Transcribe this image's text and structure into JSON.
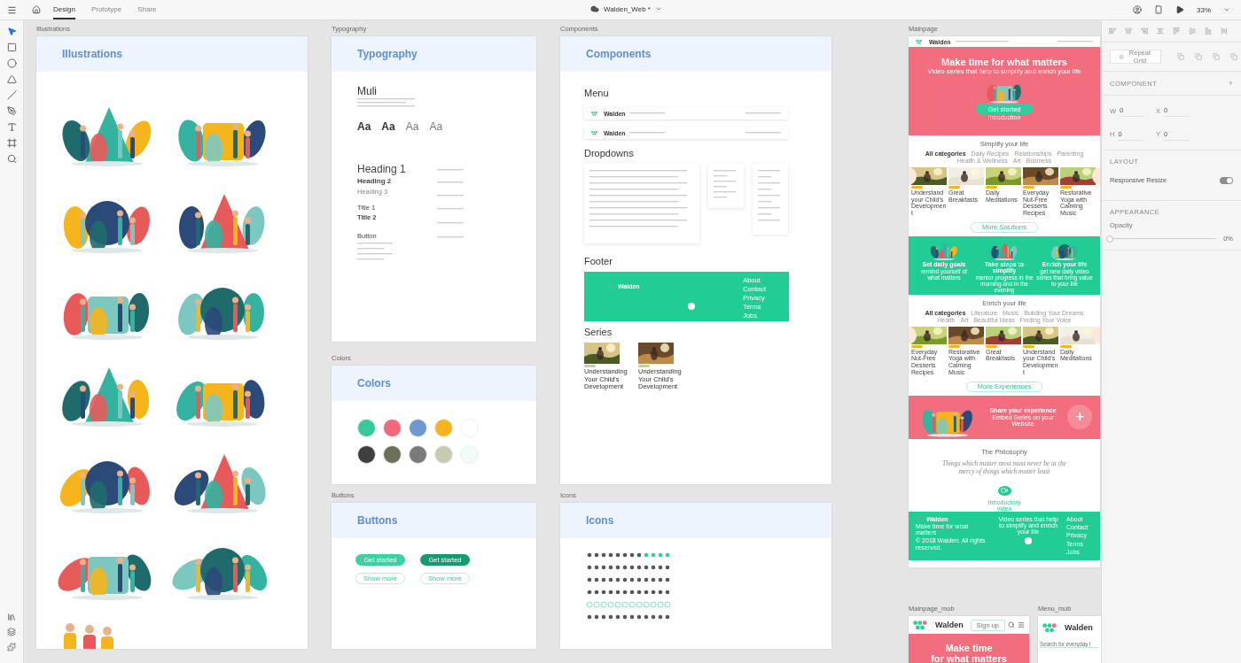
{
  "toolbar": {
    "tabs": [
      {
        "label": "Design",
        "selected": true
      },
      {
        "label": "Prototype",
        "selected": false
      },
      {
        "label": "Share",
        "selected": false
      }
    ],
    "document_title": "Walden_Web *",
    "zoom": "33%"
  },
  "tools": [
    {
      "kind": "select",
      "selected": true
    },
    {
      "kind": "rectangle",
      "selected": false
    },
    {
      "kind": "ellipse",
      "selected": false
    },
    {
      "kind": "triangle",
      "selected": false
    },
    {
      "kind": "line",
      "selected": false
    },
    {
      "kind": "pen",
      "selected": false
    },
    {
      "kind": "text",
      "selected": false
    },
    {
      "kind": "artboard",
      "selected": false
    },
    {
      "kind": "zoom",
      "selected": false
    }
  ],
  "bottom_tools": [
    {
      "kind": "assets"
    },
    {
      "kind": "layers"
    },
    {
      "kind": "plugins"
    }
  ],
  "illustrations_board": {
    "label": "Illustrations",
    "title": "Illustrations"
  },
  "typography_board": {
    "label": "Typography",
    "title": "Typography",
    "font": "Muli",
    "samples": [
      "Aa",
      "Aa",
      "Aa",
      "Aa"
    ],
    "styles": [
      {
        "label": "Heading 1",
        "kind": "h1"
      },
      {
        "label": "Heading 2",
        "kind": "h2"
      },
      {
        "label": "Heading 3",
        "kind": "h3"
      },
      {
        "label": "Title 1",
        "kind": "t1"
      },
      {
        "label": "Title 2",
        "kind": "t2"
      },
      {
        "label": "Button",
        "kind": "button"
      }
    ]
  },
  "colors_board": {
    "label": "Colors",
    "title": "Colors",
    "swatches": [
      {
        "color": "#35c99b"
      },
      {
        "color": "#f1697b"
      },
      {
        "color": "#6f98d2"
      },
      {
        "color": "#f6b51c"
      },
      {
        "color": "#ffffff"
      },
      {
        "color": "#3f3f3f"
      },
      {
        "color": "#6e7158"
      },
      {
        "color": "#7a7a7a"
      },
      {
        "color": "#c8cab4"
      },
      {
        "color": "#f1fbf7"
      }
    ]
  },
  "buttons_board": {
    "label": "Buttons",
    "title": "Buttons",
    "buttons": [
      {
        "label": "Get started",
        "kind": "primary"
      },
      {
        "label": "Get started",
        "kind": "pressed"
      },
      {
        "label": "Show more",
        "kind": "outline"
      },
      {
        "label": "Show more",
        "kind": "outline"
      }
    ]
  },
  "components_board": {
    "label": "Components",
    "title": "Components",
    "sections": [
      "Menu",
      "Dropdowns",
      "Footer",
      "Series"
    ],
    "menu_brands": [
      "Walden",
      "Walden"
    ],
    "footer_brand": "Walden",
    "footer_links": [
      "About",
      "Contact",
      "Privacy",
      "Terms",
      "Jobs"
    ],
    "series": [
      "Understanding Your Child's Development",
      "Understanding Your Child's Development"
    ]
  },
  "icons_board": {
    "label": "Icons",
    "title": "Icons"
  },
  "mainpage": {
    "label": "Mainpage",
    "brand": "Walden",
    "hero": {
      "title": "Make time for what matters",
      "subtitle": "Video series that help to simplify and enrich your life",
      "button": "Get started",
      "link": "Introduction"
    },
    "sections": [
      {
        "title": "Simplify your life",
        "tabs": [
          {
            "label": "All categories",
            "selected": true
          },
          {
            "label": "Daily Recipes",
            "selected": false
          },
          {
            "label": "Relationships",
            "selected": false
          },
          {
            "label": "Parenting",
            "selected": false
          },
          {
            "label": "Health & Wellness",
            "selected": false
          },
          {
            "label": "Art",
            "selected": false
          },
          {
            "label": "Business",
            "selected": false
          }
        ],
        "cards": [
          "Understand your Child's Development",
          "Great Breakfasts",
          "Daily Meditations",
          "Everyday Nut-Free Desserts Recipes",
          "Restorative Yoga with Calming Music"
        ],
        "button": "More Solutions"
      },
      {
        "title": "Enrich your life",
        "tabs": [
          {
            "label": "All categories",
            "selected": true
          },
          {
            "label": "Literature",
            "selected": false
          },
          {
            "label": "Music",
            "selected": false
          },
          {
            "label": "Building Your Dreams",
            "selected": false
          },
          {
            "label": "Health",
            "selected": false
          },
          {
            "label": "Art",
            "selected": false
          },
          {
            "label": "Beautiful Ideas",
            "selected": false
          },
          {
            "label": "Finding Your Voice",
            "selected": false
          }
        ],
        "cards": [
          "Everyday Nut-Free Desserts Recipes",
          "Restorative Yoga with Calming Music",
          "Great Breakfasts",
          "Understand your Child's Development",
          "Daily Meditations"
        ],
        "button": "More Experiences"
      }
    ],
    "steps": [
      {
        "title": "Set daily goals",
        "text": "remind yourself of what matters"
      },
      {
        "title": "Take steps to simplify",
        "text": "mentor progress in the morning and in the evening"
      },
      {
        "title": "Enrich your life",
        "text": "get new daily video series that bring value to your life"
      }
    ],
    "share": {
      "title": "Share your experience",
      "text": "Embed Series on your Website",
      "icon": "+"
    },
    "philosophy": {
      "title": "The Philosophy",
      "quote": "Things which matter most must never be at the mercy of things which matter least",
      "video": "Introductory video"
    },
    "footer": {
      "brand": "Walden",
      "tagline": "Make time for what matters",
      "copyright": "© 2018 Walden. All rights reserved.",
      "text": "Video series that help to simplify and enrich your life",
      "links": [
        "About",
        "Contact",
        "Privacy",
        "Terms",
        "Jobs"
      ]
    }
  },
  "mobile_board": {
    "label": "Mainpage_mob",
    "brand": "Walden",
    "button": "Sign up",
    "title": "Make time",
    "title_2": "for what matters"
  },
  "menu_mobile_board": {
    "label": "Menu_mob",
    "brand": "Walden",
    "placeholder": "Search for everyday l"
  },
  "properties": {
    "repeat_grid": "Repeat Grid",
    "component_heading": "COMPONENT",
    "add": "+",
    "fields": [
      {
        "label": "W",
        "value": "0"
      },
      {
        "label": "X",
        "value": "0"
      },
      {
        "label": "H",
        "value": "0"
      },
      {
        "label": "Y",
        "value": "0"
      }
    ],
    "layout_heading": "LAYOUT",
    "responsive_resize": {
      "label": "Responsive Resize",
      "on": true
    },
    "appearance_heading": "APPEARANCE",
    "opacity": {
      "label": "Opacity",
      "level": 0,
      "reading": "0%"
    }
  }
}
